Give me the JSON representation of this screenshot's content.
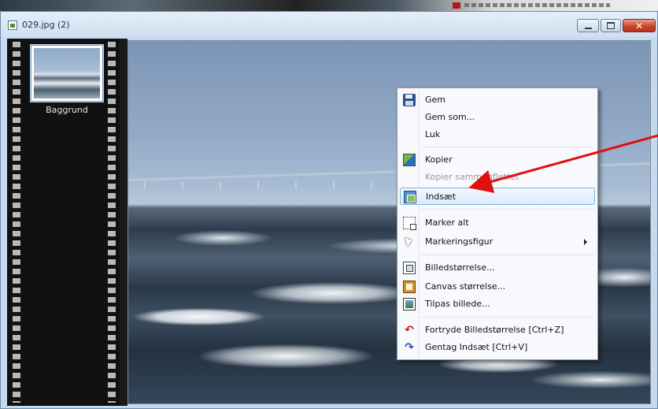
{
  "window": {
    "title": "029.jpg (2)",
    "controls": {
      "minimize_icon": "minimize-icon",
      "maximize_icon": "maximize-icon",
      "close_icon": "close-icon"
    }
  },
  "filmstrip": {
    "layers": [
      {
        "label": "Baggrund",
        "selected": true
      }
    ]
  },
  "context_menu": {
    "items": [
      {
        "label": "Gem",
        "icon": "save-icon",
        "enabled": true
      },
      {
        "label": "Gem som...",
        "icon": "",
        "enabled": true
      },
      {
        "label": "Luk",
        "icon": "",
        "enabled": true
      },
      {
        "label": "Kopier",
        "icon": "copy-icon",
        "enabled": true
      },
      {
        "label": "Kopier sammenflettet",
        "icon": "",
        "enabled": false
      },
      {
        "label": "Indsæt",
        "icon": "paste-icon",
        "enabled": true,
        "highlighted": true
      },
      {
        "label": "Marker alt",
        "icon": "select-all-icon",
        "enabled": true
      },
      {
        "label": "Markeringsfigur",
        "icon": "selection-shape-icon",
        "enabled": true,
        "submenu": true
      },
      {
        "label": "Billedstørrelse...",
        "icon": "image-size-icon",
        "enabled": true
      },
      {
        "label": "Canvas størrelse...",
        "icon": "canvas-size-icon",
        "enabled": true
      },
      {
        "label": "Tilpas billede...",
        "icon": "fit-image-icon",
        "enabled": true
      },
      {
        "label": "Fortryde Billedstørrelse [Ctrl+Z]",
        "icon": "undo-icon",
        "enabled": true
      },
      {
        "label": "Gentag Indsæt [Ctrl+V]",
        "icon": "redo-icon",
        "enabled": true
      }
    ]
  },
  "annotation": {
    "type": "arrow",
    "color": "#e01010",
    "points_to": "Indsæt"
  },
  "colors": {
    "menu_highlight": "#d9ebfb",
    "close_button": "#c8452b",
    "annotation": "#e01010"
  }
}
